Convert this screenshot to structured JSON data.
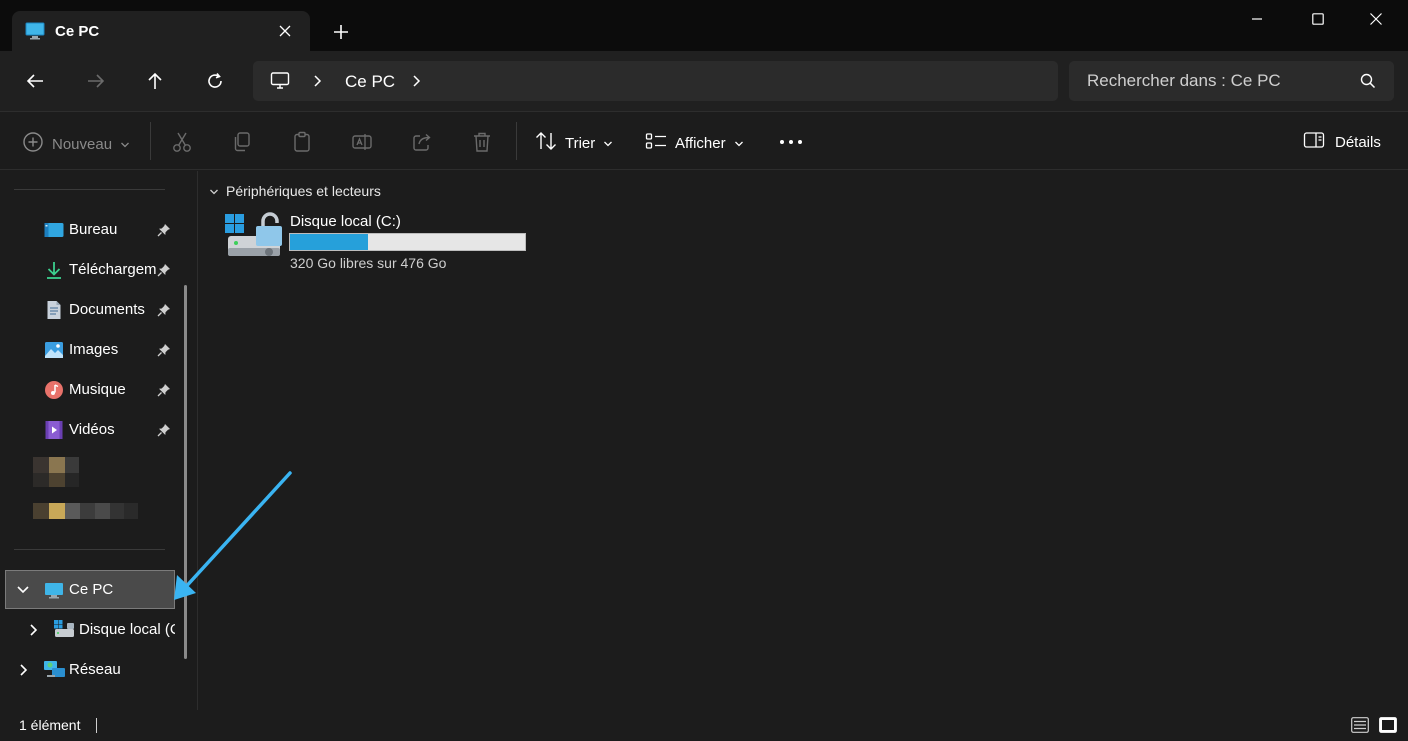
{
  "window": {
    "tab_title": "Ce PC",
    "accent": "#26a0da"
  },
  "nav": {
    "breadcrumb": "Ce PC",
    "search_placeholder": "Rechercher dans : Ce PC"
  },
  "toolbar": {
    "new_label": "Nouveau",
    "sort_label": "Trier",
    "view_label": "Afficher",
    "details_label": "Détails"
  },
  "sidebar": {
    "quick_access": [
      {
        "label": "Bureau",
        "icon": "desktop-icon"
      },
      {
        "label": "Téléchargements",
        "icon": "download-icon"
      },
      {
        "label": "Documents",
        "icon": "document-icon"
      },
      {
        "label": "Images",
        "icon": "image-icon"
      },
      {
        "label": "Musique",
        "icon": "music-icon"
      },
      {
        "label": "Vidéos",
        "icon": "video-icon"
      }
    ],
    "this_pc": "Ce PC",
    "local_disk": "Disque local (C:)",
    "network": "Réseau"
  },
  "content": {
    "group_title": "Périphériques et lecteurs",
    "drive": {
      "name": "Disque local (C:)",
      "free_text": "320 Go libres sur 476 Go",
      "used_fraction": 0.33
    }
  },
  "status": {
    "count": "1 élément"
  }
}
